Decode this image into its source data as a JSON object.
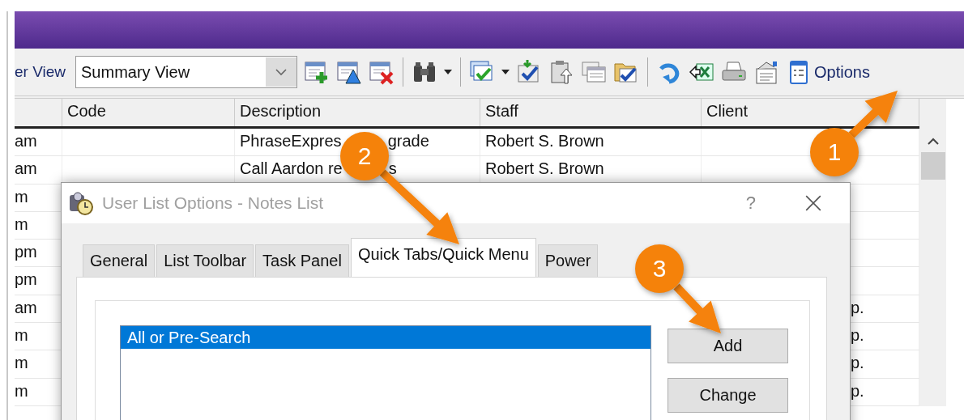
{
  "toolbar": {
    "view_label": "er View",
    "view_select": "Summary View",
    "options_label": "Options"
  },
  "table": {
    "columns": [
      "Code",
      "Description",
      "Staff",
      "Client"
    ],
    "rows": [
      {
        "time": "am",
        "description": [
          "PhraseExpres",
          "grade"
        ],
        "staff": "Robert S. Brown"
      },
      {
        "time": "am",
        "description": [
          "Call Aardon re",
          "s"
        ],
        "staff": "Robert S. Brown"
      },
      {
        "time": "m"
      },
      {
        "time": "m"
      },
      {
        "time": "pm"
      },
      {
        "time": "pm"
      },
      {
        "time": "am",
        "client": "p."
      },
      {
        "time": "m",
        "client": "p."
      },
      {
        "time": "m",
        "client": "p."
      },
      {
        "time": "m",
        "client": "p."
      }
    ]
  },
  "dialog": {
    "title": "User List Options - Notes List",
    "help": "?",
    "tabs": [
      {
        "label": "General",
        "selected": false
      },
      {
        "label": "List Toolbar",
        "selected": false
      },
      {
        "label": "Task Panel",
        "selected": false
      },
      {
        "label": "Quick Tabs/Quick Menu",
        "selected": true
      },
      {
        "label": "Power",
        "selected": false
      }
    ],
    "list_items": [
      {
        "label": "All or Pre-Search",
        "selected": true
      }
    ],
    "buttons": [
      "Add",
      "Change"
    ]
  },
  "callouts": [
    {
      "number": "1"
    },
    {
      "number": "2"
    },
    {
      "number": "3"
    }
  ]
}
